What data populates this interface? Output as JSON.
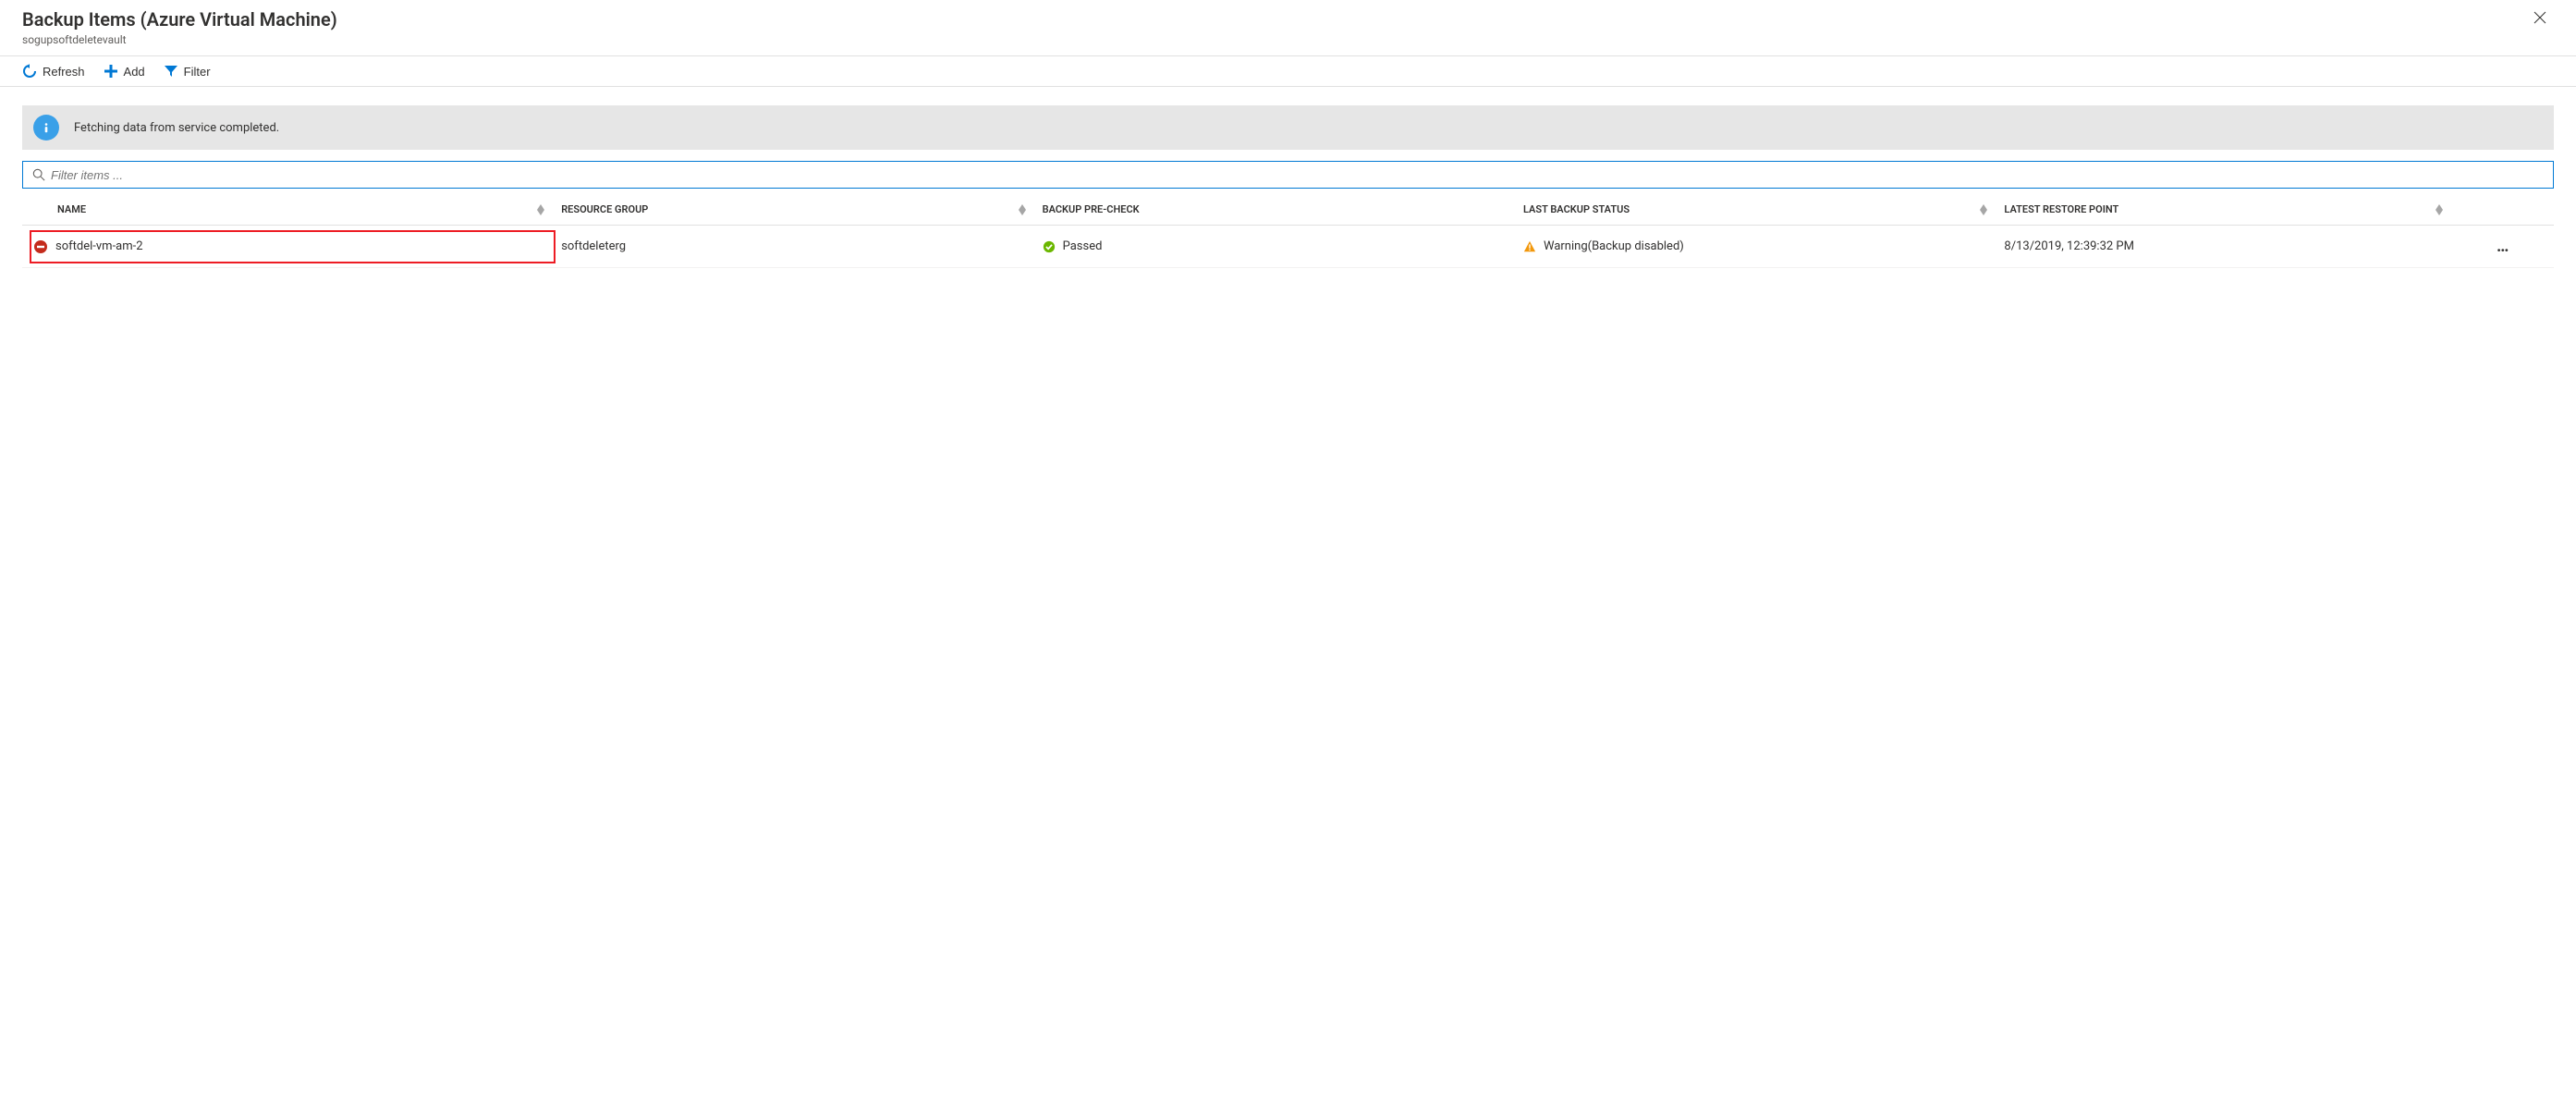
{
  "header": {
    "title": "Backup Items (Azure Virtual Machine)",
    "subtitle": "sogupsoftdeletevault"
  },
  "toolbar": {
    "refresh_label": "Refresh",
    "add_label": "Add",
    "filter_label": "Filter"
  },
  "notification": {
    "message": "Fetching data from service completed."
  },
  "filter": {
    "placeholder": "Filter items ..."
  },
  "columns": {
    "name": "Name",
    "resource_group": "Resource Group",
    "backup_precheck": "Backup Pre-Check",
    "last_backup_status": "Last Backup Status",
    "latest_restore_point": "Latest Restore Point"
  },
  "rows": [
    {
      "name": "softdel-vm-am-2",
      "resource_group": "softdeleterg",
      "precheck_status": "Passed",
      "last_backup_status": "Warning(Backup disabled)",
      "latest_restore_point": "8/13/2019, 12:39:32 PM"
    }
  ]
}
